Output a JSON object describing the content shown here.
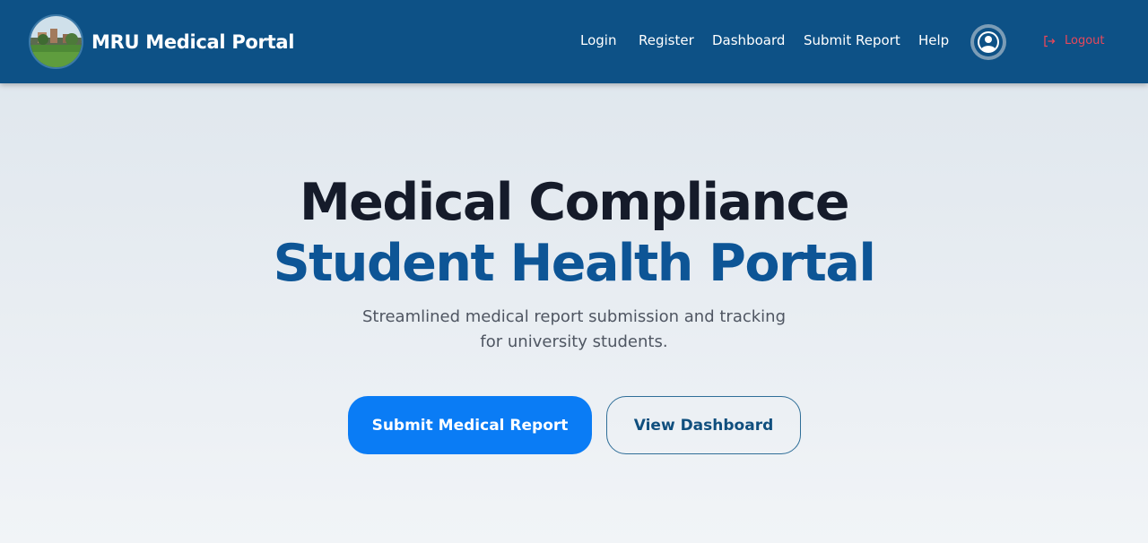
{
  "navbar": {
    "brand_name": "MRU Medical Portal",
    "links": [
      {
        "label": "Login"
      },
      {
        "label": "Register"
      },
      {
        "label": "Dashboard"
      },
      {
        "label": "Submit Report"
      },
      {
        "label": "Help"
      }
    ],
    "logout_label": "Logout",
    "background_color": "#0d5186",
    "logout_color": "#e8485a"
  },
  "hero": {
    "title_line1": "Medical Compliance",
    "title_line2": "Student Health Portal",
    "subtitle": "Streamlined medical report submission and tracking for university students.",
    "primary_button": "Submit Medical Report",
    "secondary_button": "View Dashboard",
    "accent_color": "#0a7cf5"
  },
  "icons": {
    "brand_logo": "campus-photo-logo",
    "avatar": "user-circle-icon",
    "logout": "logout-icon"
  }
}
